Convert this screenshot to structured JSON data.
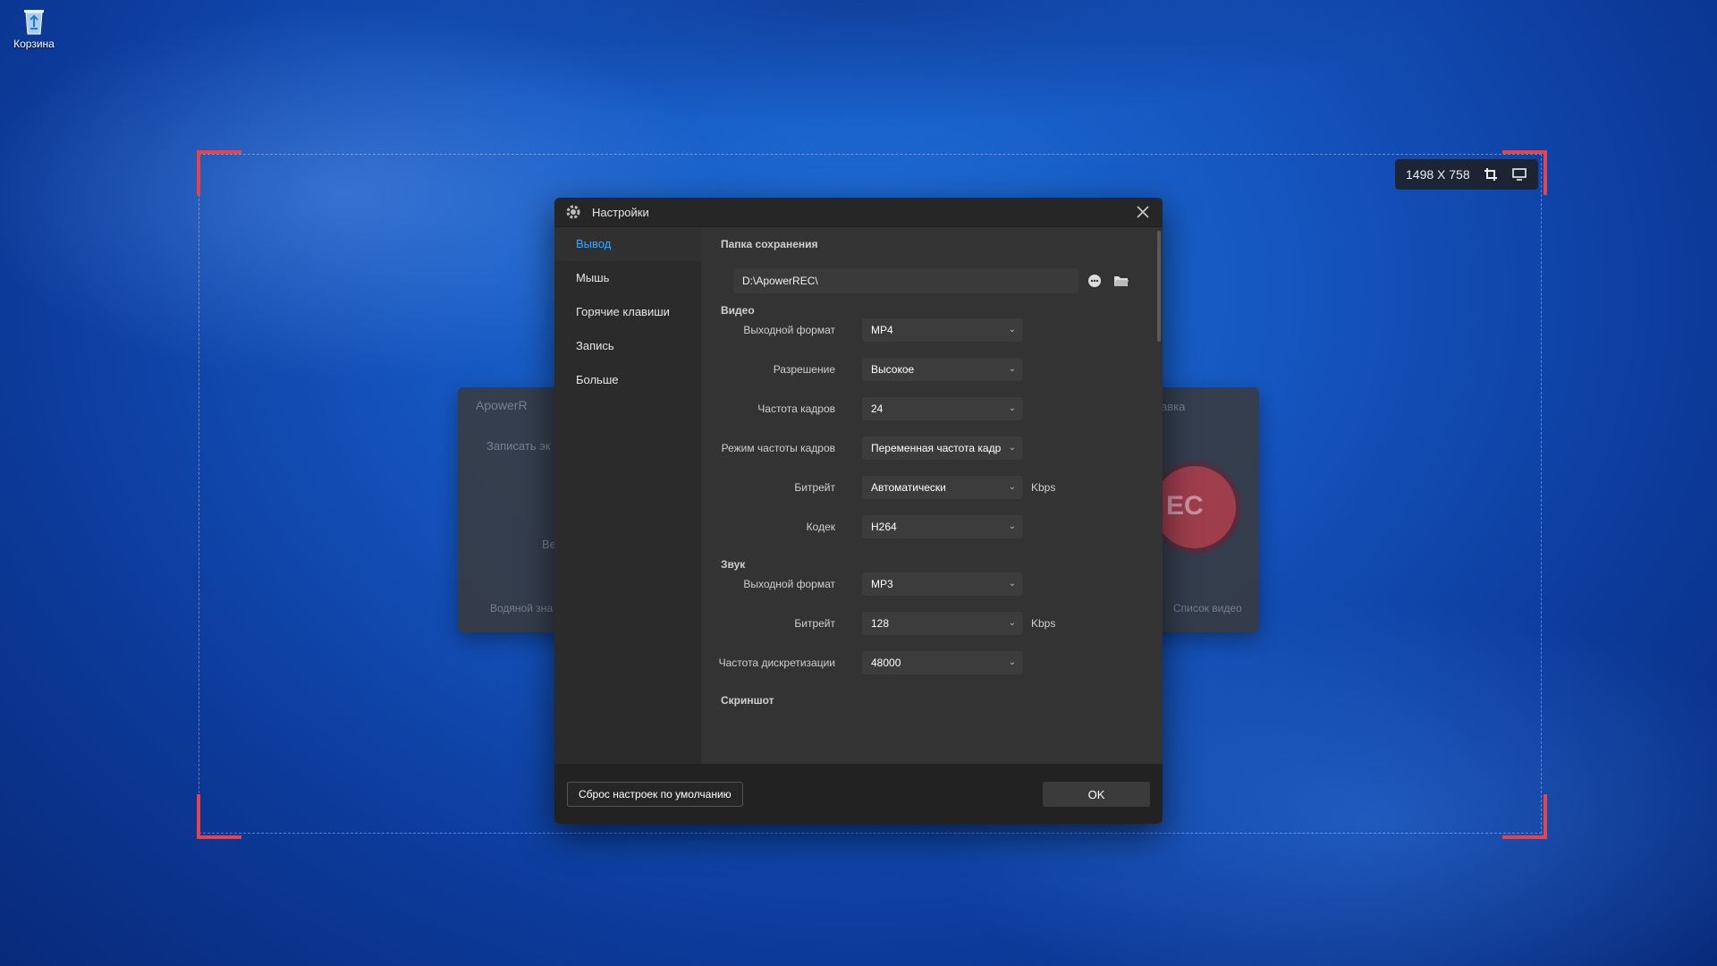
{
  "desktop": {
    "recycle_bin_label": "Корзина"
  },
  "capture": {
    "size_text": "1498 X 758",
    "crop_icon": "crop-icon",
    "screen_icon": "monitor-icon",
    "accent": "#e8434a"
  },
  "background_window": {
    "title": "ApowerR",
    "subtitle": "Записать эк",
    "partial_label": "Ве",
    "watermark_label": "Водяной зна",
    "right_title": "авка",
    "list_label": "Список видео",
    "rec_text": "EC"
  },
  "dialog": {
    "title": "Настройки",
    "sidebar": [
      {
        "label": "Вывод",
        "active": true
      },
      {
        "label": "Мышь",
        "active": false
      },
      {
        "label": "Горячие клавиши",
        "active": false
      },
      {
        "label": "Запись",
        "active": false
      },
      {
        "label": "Больше",
        "active": false
      }
    ],
    "save_folder": {
      "heading": "Папка сохранения",
      "path": "D:\\ApowerREC\\"
    },
    "video": {
      "heading": "Видео",
      "format_label": "Выходной формат",
      "format_value": "MP4",
      "resolution_label": "Разрешение",
      "resolution_value": "Высокое",
      "fps_label": "Частота кадров",
      "fps_value": "24",
      "fps_mode_label": "Режим частоты кадров",
      "fps_mode_value": "Переменная частота кадр",
      "bitrate_label": "Битрейт",
      "bitrate_value": "Автоматически",
      "bitrate_unit": "Kbps",
      "codec_label": "Кодек",
      "codec_value": "H264"
    },
    "audio": {
      "heading": "Звук",
      "format_label": "Выходной формат",
      "format_value": "MP3",
      "bitrate_label": "Битрейт",
      "bitrate_value": "128",
      "bitrate_unit": "Kbps",
      "sample_label": "Частота дискретизации",
      "sample_value": "48000"
    },
    "screenshot": {
      "heading": "Скриншот"
    },
    "footer": {
      "reset_label": "Сброс настроек по умолчанию",
      "ok_label": "OK"
    },
    "active_color": "#3aa6ff"
  }
}
